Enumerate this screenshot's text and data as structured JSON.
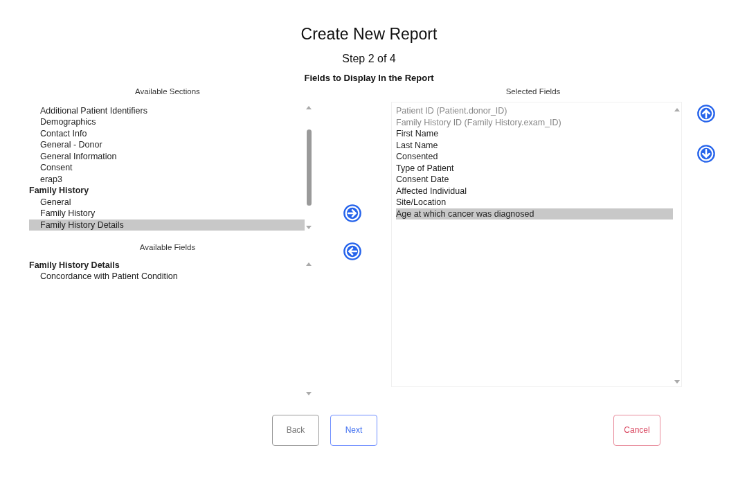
{
  "title": "Create New Report",
  "step": "Step 2 of 4",
  "subtitle": "Fields to Display In the Report",
  "sections": {
    "label": "Available Sections",
    "items": [
      {
        "kind": "item",
        "text": "Additional Patient Identifiers",
        "selected": false
      },
      {
        "kind": "item",
        "text": "Demographics",
        "selected": false
      },
      {
        "kind": "item",
        "text": "Contact Info",
        "selected": false
      },
      {
        "kind": "item",
        "text": "General - Donor",
        "selected": false
      },
      {
        "kind": "item",
        "text": "General Information",
        "selected": false
      },
      {
        "kind": "item",
        "text": "Consent",
        "selected": false
      },
      {
        "kind": "item",
        "text": "erap3",
        "selected": false
      },
      {
        "kind": "group",
        "text": "Family History",
        "selected": false
      },
      {
        "kind": "item",
        "text": "General",
        "selected": false
      },
      {
        "kind": "item",
        "text": "Family History",
        "selected": false
      },
      {
        "kind": "item",
        "text": "Family History Details",
        "selected": true
      }
    ]
  },
  "fields": {
    "label": "Available Fields",
    "items": [
      {
        "kind": "group",
        "text": "Family History Details",
        "selected": false
      },
      {
        "kind": "item",
        "text": "Concordance with Patient Condition",
        "selected": false
      }
    ]
  },
  "selected_fields": {
    "label": "Selected Fields",
    "items": [
      {
        "text": "Patient ID (Patient.donor_ID)",
        "disabled": true,
        "selected": false
      },
      {
        "text": "Family History ID (Family History.exam_ID)",
        "disabled": true,
        "selected": false
      },
      {
        "text": "First Name",
        "disabled": false,
        "selected": false
      },
      {
        "text": "Last Name",
        "disabled": false,
        "selected": false
      },
      {
        "text": "Consented",
        "disabled": false,
        "selected": false
      },
      {
        "text": "Type of Patient",
        "disabled": false,
        "selected": false
      },
      {
        "text": "Consent Date",
        "disabled": false,
        "selected": false
      },
      {
        "text": "Affected Individual",
        "disabled": false,
        "selected": false
      },
      {
        "text": "Site/Location",
        "disabled": false,
        "selected": false
      },
      {
        "text": "Age at which cancer was diagnosed",
        "disabled": false,
        "selected": true
      }
    ]
  },
  "buttons": [
    {
      "kind": "back",
      "label": "Back"
    },
    {
      "kind": "next",
      "label": "Next"
    },
    {
      "kind": "cancel",
      "label": "Cancel"
    }
  ]
}
